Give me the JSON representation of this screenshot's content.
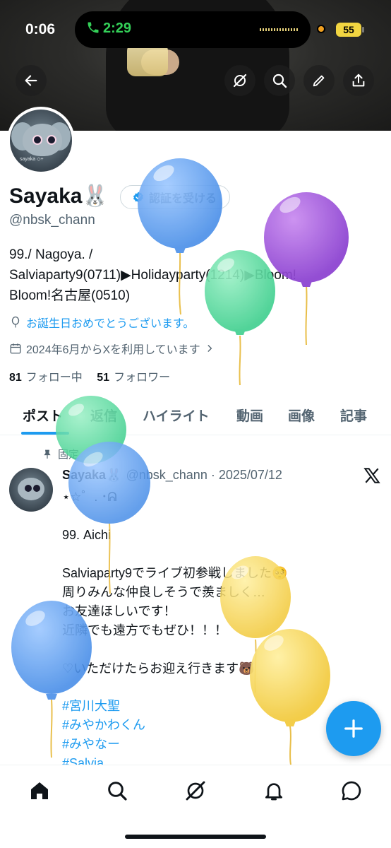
{
  "status_bar": {
    "time": "0:06",
    "call_duration": "2:29",
    "battery": "55"
  },
  "header": {
    "back_icon": "arrow-left-icon",
    "actions": [
      "grok-icon",
      "search-icon",
      "edit-icon",
      "share-icon"
    ]
  },
  "profile": {
    "display_name": "Sayaka🐰",
    "verify_button": "認証を受ける",
    "handle": "@nbsk_chann",
    "bio_lines": [
      "99./ Nagoya. /",
      "Salviaparty9(0711)▶Holidayparty(1214)▶Bloom!",
      "Bloom!名古屋(0510)"
    ],
    "birthday": "お誕生日おめでとうございます。",
    "joined": "2024年6月からXを利用しています",
    "following_count": "81",
    "following_label": "フォロー中",
    "followers_count": "51",
    "followers_label": "フォロワー",
    "avatar_text": "sayaka ◇+"
  },
  "tabs": [
    {
      "label": "ポスト",
      "active": true
    },
    {
      "label": "返信",
      "active": false
    },
    {
      "label": "ハイライト",
      "active": false
    },
    {
      "label": "動画",
      "active": false
    },
    {
      "label": "画像",
      "active": false
    },
    {
      "label": "記事",
      "active": false
    }
  ],
  "post": {
    "pinned_label": "固定",
    "author_name": "Sayaka🐰",
    "author_meta": "@nbsk_chann · 2025/07/12",
    "body": "⋆☆゜. ･ᕱ\n\n99.  Aichi\n\nSalviaparty9でライブ初参戦しました🥺\n周りみんな仲良しそうで羨ましく…\nお友達ほしいです！\n近隣でも遠方でもぜひ！！！\n\n♡いただけたらお迎え行きます🐻",
    "hashtags": [
      "#宮川大聖",
      "#みやかわくん",
      "#みやなー",
      "#Salvia"
    ]
  },
  "fab": {
    "icon": "plus-icon"
  },
  "bottom_nav": [
    "home-icon",
    "search-icon",
    "grok-icon",
    "notifications-icon",
    "messages-icon"
  ],
  "colors": {
    "accent": "#1d9bf0",
    "text": "#0f1419",
    "muted": "#536471"
  }
}
